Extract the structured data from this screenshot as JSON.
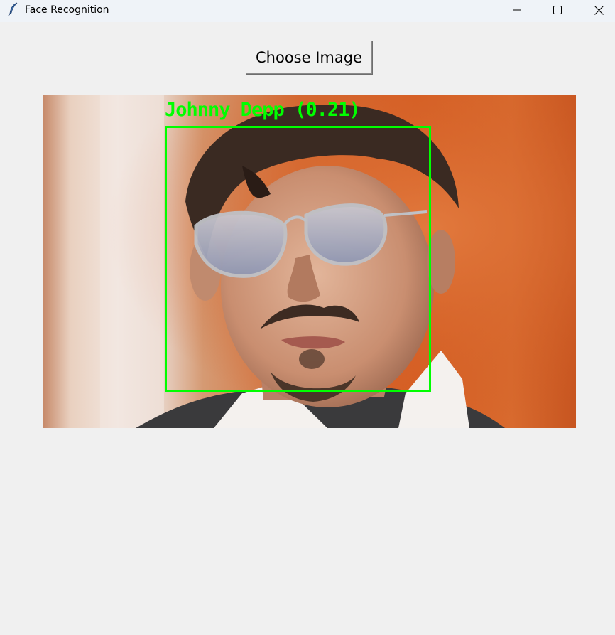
{
  "window": {
    "title": "Face Recognition",
    "app_icon": "feather-icon",
    "controls": {
      "minimize_icon": "minimize-icon",
      "maximize_icon": "maximize-icon",
      "close_icon": "close-icon"
    }
  },
  "toolbar": {
    "choose_label": "Choose Image"
  },
  "result": {
    "detection_label": "Johnny Depp (0.21)",
    "box_color": "#00ff00"
  }
}
